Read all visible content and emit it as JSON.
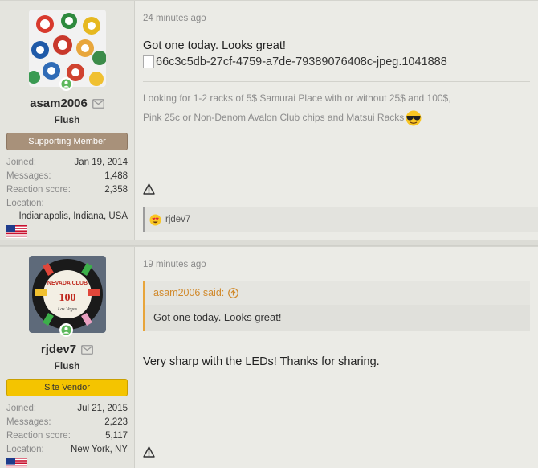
{
  "posts": [
    {
      "user": {
        "name": "asam2006",
        "title": "Flush",
        "banner": "Supporting Member",
        "joined_label": "Joined:",
        "joined": "Jan 19, 2014",
        "messages_label": "Messages:",
        "messages": "1,488",
        "reaction_label": "Reaction score:",
        "reaction": "2,358",
        "location_label": "Location:",
        "location": "Indianapolis, Indiana, USA"
      },
      "time": "24 minutes ago",
      "message": "Got one today. Looks great!",
      "image_alt": "66c3c5db-27cf-4759-a7de-79389076408c-jpeg.1041888",
      "signature_line1": "Looking for 1-2 racks of 5$ Samurai Place with or without 25$ and 100$,",
      "signature_line2": "Pink 25c or Non-Denom Avalon Club chips and Matsui Racks",
      "reaction_user": "rjdev7"
    },
    {
      "user": {
        "name": "rjdev7",
        "title": "Flush",
        "banner": "Site Vendor",
        "joined_label": "Joined:",
        "joined": "Jul 21, 2015",
        "messages_label": "Messages:",
        "messages": "2,223",
        "reaction_label": "Reaction score:",
        "reaction": "5,117",
        "location_label": "Location:",
        "location": "New York, NY"
      },
      "time": "19 minutes ago",
      "quote_author": "asam2006 said:",
      "quote_text": "Got one today. Looks great!",
      "message": "Very sharp with the LEDs! Thanks for sharing."
    }
  ],
  "colors": {
    "supporting_banner": "#a8917a",
    "vendor_banner": "#f4c400",
    "quote_accent": "#e8a53b",
    "online": "#5cb85c"
  }
}
